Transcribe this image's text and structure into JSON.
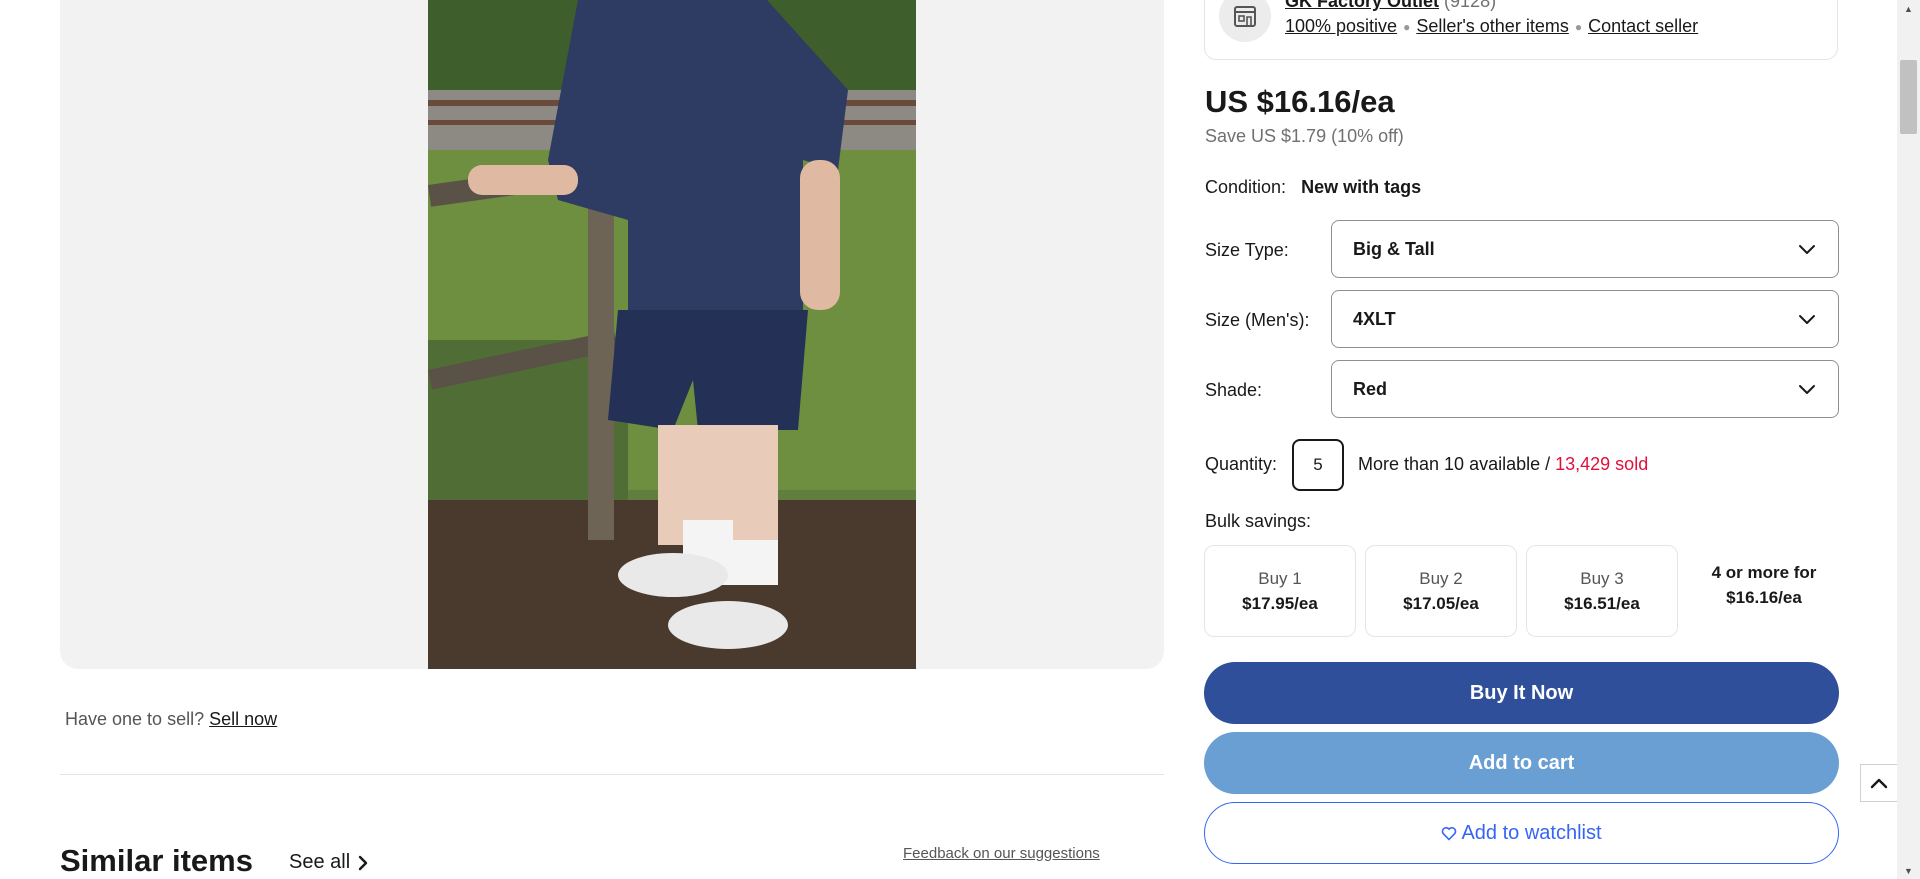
{
  "seller": {
    "name": "GK Factory Outlet",
    "feedback_count": "(9128)",
    "positive": "100% positive",
    "other_items": "Seller's other items",
    "contact": "Contact seller"
  },
  "price": {
    "main": "US $16.16/ea",
    "save": "Save US $1.79 (10% off)"
  },
  "condition": {
    "label": "Condition:",
    "value": "New with tags"
  },
  "selects": [
    {
      "label": "Size Type:",
      "value": "Big & Tall"
    },
    {
      "label": "Size (Men's):",
      "value": "4XLT"
    },
    {
      "label": "Shade:",
      "value": "Red"
    }
  ],
  "quantity": {
    "label": "Quantity:",
    "value": "5",
    "available": "More than 10 available / ",
    "sold": "13,429 sold"
  },
  "bulk": {
    "label": "Bulk savings:",
    "tiers": [
      {
        "label": "Buy 1",
        "price": "$17.95/ea"
      },
      {
        "label": "Buy 2",
        "price": "$17.05/ea"
      },
      {
        "label": "Buy 3",
        "price": "$16.51/ea"
      }
    ],
    "last_line1": "4 or more for",
    "last_line2": "$16.16/ea"
  },
  "buttons": {
    "buy": "Buy It Now",
    "cart": "Add to cart",
    "watch": "Add to watchlist"
  },
  "sell": {
    "prompt": "Have one to sell?",
    "link": "Sell now"
  },
  "similar": {
    "title": "Similar items",
    "see_all": "See all",
    "feedback": "Feedback on our suggestions"
  },
  "colors": {
    "buy_button": "#2f4f9a",
    "cart_button": "#6a9fd4",
    "watch_accent": "#3665f3",
    "sold_text": "#e0103a"
  },
  "icons": {
    "store": "store-icon",
    "chevron": "chevron-down-icon",
    "heart": "heart-icon",
    "arrow": "chevron-right-icon",
    "back_to_top": "chevron-up-icon"
  }
}
